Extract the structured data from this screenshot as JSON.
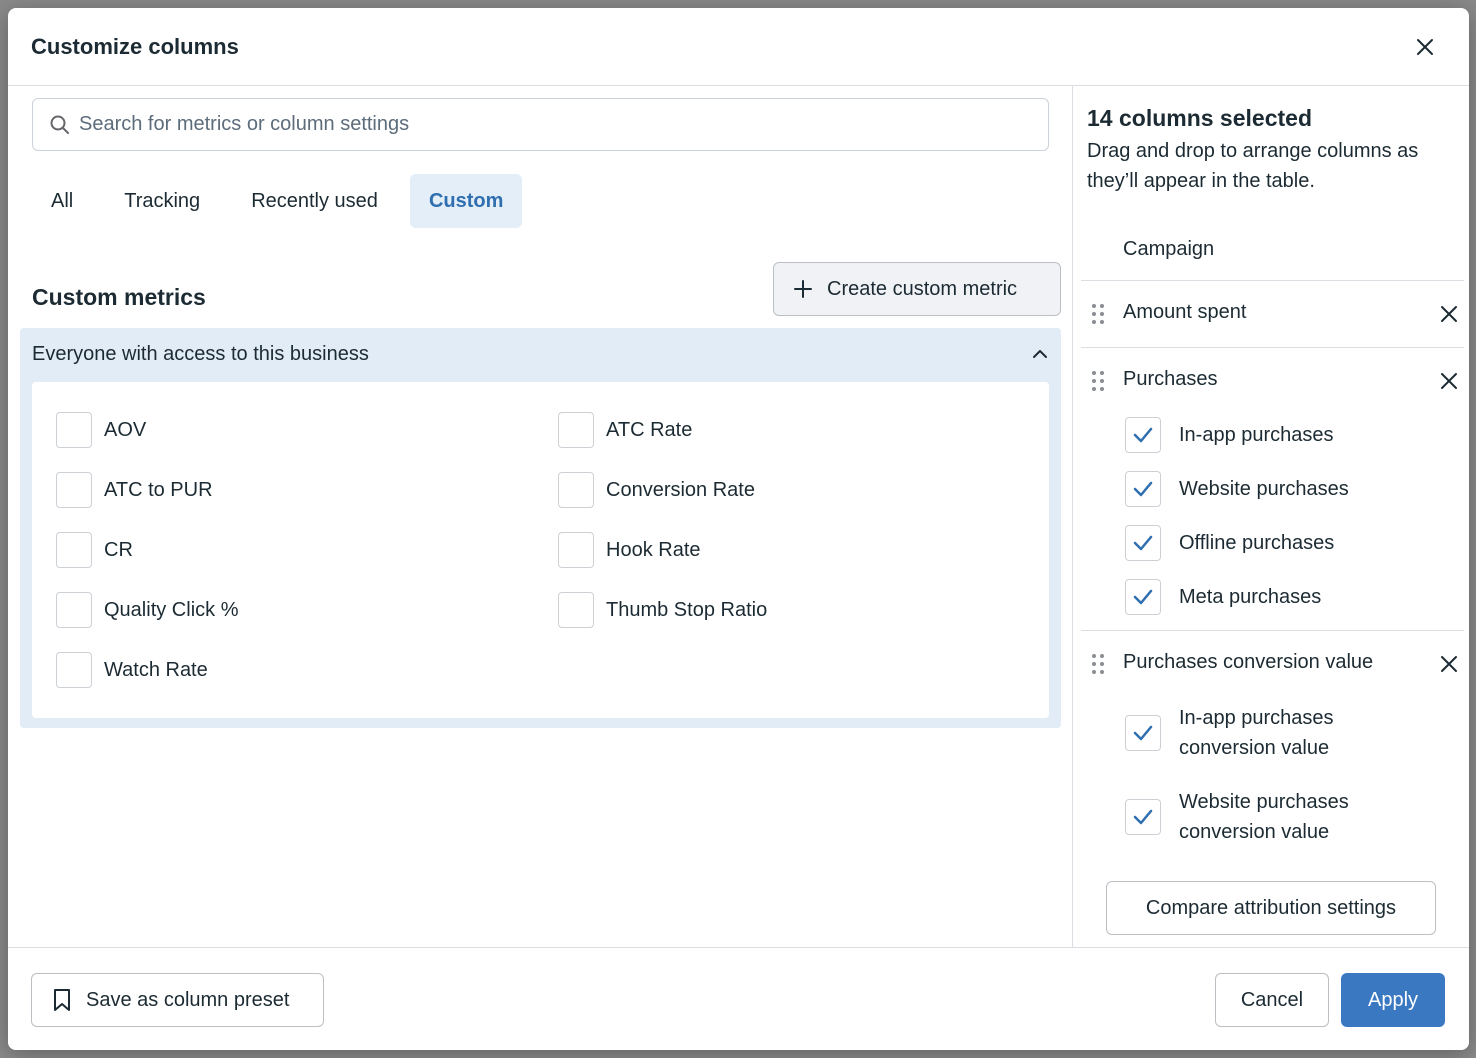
{
  "modal": {
    "title": "Customize columns"
  },
  "search": {
    "placeholder": "Search for metrics or column settings",
    "value": ""
  },
  "tabs": [
    {
      "label": "All",
      "active": false
    },
    {
      "label": "Tracking",
      "active": false
    },
    {
      "label": "Recently used",
      "active": false
    },
    {
      "label": "Custom",
      "active": true
    }
  ],
  "custom_metrics": {
    "title": "Custom metrics",
    "create_label": "Create custom metric",
    "group_label": "Everyone with access to this business",
    "items": [
      {
        "label": "AOV",
        "checked": false
      },
      {
        "label": "ATC Rate",
        "checked": false
      },
      {
        "label": "ATC to PUR",
        "checked": false
      },
      {
        "label": "Conversion Rate",
        "checked": false
      },
      {
        "label": "CR",
        "checked": false
      },
      {
        "label": "Hook Rate",
        "checked": false
      },
      {
        "label": "Quality Click %",
        "checked": false
      },
      {
        "label": "Thumb Stop Ratio",
        "checked": false
      },
      {
        "label": "Watch Rate",
        "checked": false
      }
    ]
  },
  "selected": {
    "title": "14 columns selected",
    "description": "Drag and drop to arrange columns as they’ll appear in the table.",
    "fixed_column": "Campaign",
    "columns": [
      {
        "label": "Amount spent",
        "sub": []
      },
      {
        "label": "Purchases",
        "sub": [
          "In-app purchases",
          "Website purchases",
          "Offline purchases",
          "Meta purchases"
        ]
      },
      {
        "label": "Purchases conversion value",
        "sub": [
          "In-app purchases conversion value",
          "Website purchases conversion value"
        ]
      }
    ],
    "compare_label": "Compare attribution settings"
  },
  "footer": {
    "save_preset_label": "Save as column preset",
    "cancel_label": "Cancel",
    "apply_label": "Apply"
  },
  "colors": {
    "accent": "#3a78c2",
    "tab_active_bg": "#e3eef8",
    "group_bg": "#e2ecf6"
  }
}
